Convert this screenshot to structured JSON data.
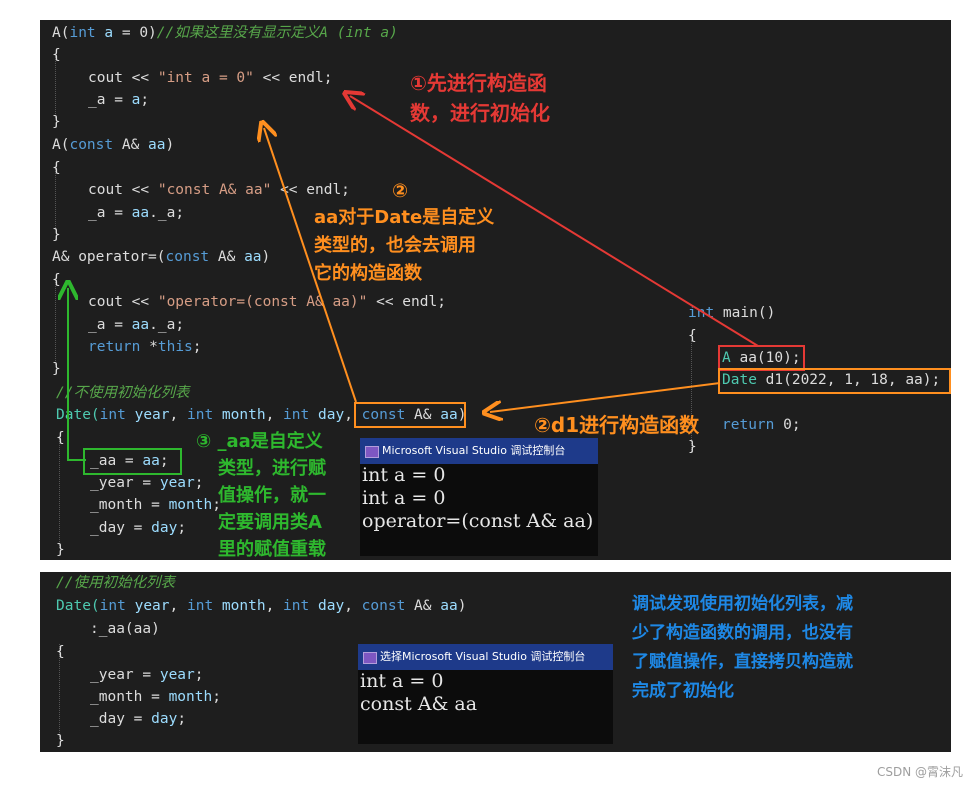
{
  "code_top": {
    "ctor_default": [
      "A(",
      "int",
      " ",
      "a",
      " = 0)",
      "//如果这里没有显示定义A (int a)"
    ],
    "brace_open": "{",
    "brace_close": "}",
    "cout_int_a": [
      "cout << ",
      "\"int a = 0\"",
      " << endl;"
    ],
    "assign_a": [
      "_a = ",
      "a",
      ";"
    ],
    "ctor_copy": [
      "A(",
      "const",
      " A& ",
      "aa",
      ")"
    ],
    "cout_copy": [
      "cout << ",
      "\"const A& aa\"",
      " << endl;"
    ],
    "assign_aa": [
      "_a = ",
      "aa",
      "._a;"
    ],
    "op_assign": [
      "A& operator=(",
      "const",
      " A& ",
      "aa",
      ")"
    ],
    "cout_op": [
      "cout << ",
      "\"operator=(const A& aa)\"",
      " << endl;"
    ],
    "return_this": [
      "return",
      " *",
      "this",
      ";"
    ],
    "comment_no_init": "//不使用初始化列表",
    "date_ctor": [
      "Date(",
      "int",
      " ",
      "year",
      ", ",
      "int",
      " ",
      "month",
      ", ",
      "int",
      " ",
      "day",
      ", ",
      "const",
      " A& ",
      "aa",
      ")"
    ],
    "date_aa": [
      "_aa = ",
      "aa",
      ";"
    ],
    "date_year": [
      "_year = ",
      "year",
      ";"
    ],
    "date_month": [
      "_month = ",
      "month",
      ";"
    ],
    "date_day": [
      "_day = ",
      "day",
      ";"
    ],
    "main_sig": [
      "int",
      " main()"
    ],
    "main_a": [
      "A",
      " aa(10);"
    ],
    "main_date": [
      "Date",
      " d1(2022, 1, 18, aa);"
    ],
    "main_return": [
      "return",
      " 0;"
    ]
  },
  "code_bottom": {
    "comment_init": "//使用初始化列表",
    "date_ctor": [
      "Date(",
      "int",
      " ",
      "year",
      ", ",
      "int",
      " ",
      "month",
      ", ",
      "int",
      " ",
      "day",
      ", ",
      "const",
      " A& ",
      "aa",
      ")"
    ],
    "init_list": ":_aa(aa)",
    "brace_open": "{",
    "brace_close": "}",
    "date_year": [
      "_year = ",
      "year",
      ";"
    ],
    "date_month": [
      "_month = ",
      "month",
      ";"
    ],
    "date_day": [
      "_day = ",
      "day",
      ";"
    ]
  },
  "console1": {
    "title": "Microsoft Visual Studio 调试控制台",
    "lines": [
      "int a = 0",
      "int a = 0",
      "operator=(const A& aa)"
    ]
  },
  "console2": {
    "title": "选择Microsoft Visual Studio 调试控制台",
    "lines": [
      "int a = 0",
      "const A& aa"
    ]
  },
  "annotations": {
    "step1": [
      "①先进行构造函",
      "数，进行初始化"
    ],
    "step2_mark": "②",
    "step2_text": [
      "aa对于Date是自定义",
      "类型的，也会去调用",
      "它的构造函数"
    ],
    "step2_d1": "②d1进行构造函数",
    "step3": [
      "③ _aa是自定义",
      "类型，进行赋",
      "值操作，就一",
      "定要调用类A",
      "里的赋值重载"
    ],
    "conclusion": [
      "调试发现使用初始化列表，减",
      "少了构造函数的调用，也没有",
      "了赋值操作，直接拷贝构造就",
      "完成了初始化"
    ]
  },
  "colors": {
    "red": "#e53935",
    "orange": "#ff8f1f",
    "green": "#2eb82e",
    "blue": "#1e88e5"
  },
  "watermark": "CSDN @霄沫凡"
}
